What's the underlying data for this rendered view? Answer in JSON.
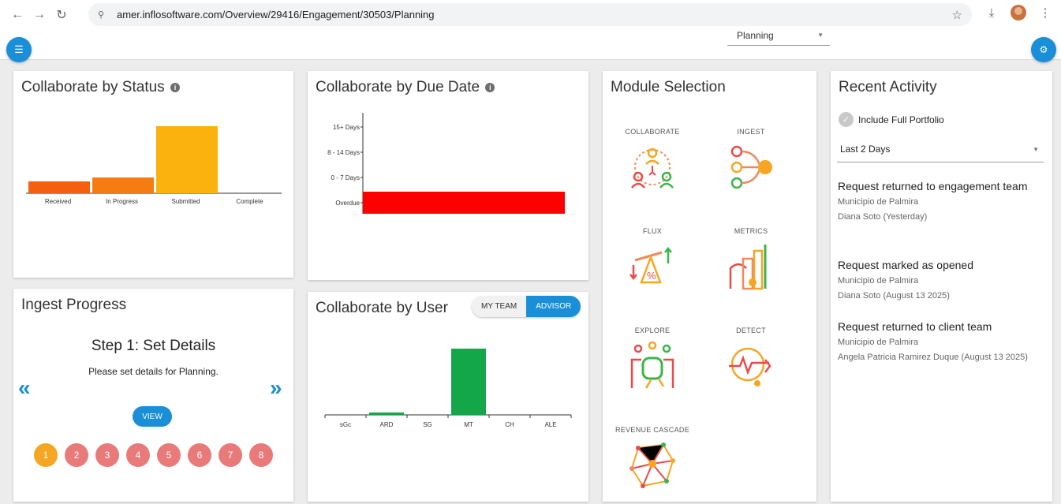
{
  "browser": {
    "url": "amer.inflosoftware.com/Overview/29416/Engagement/30503/Planning",
    "back_icon": "arrow-left-icon",
    "forward_icon": "arrow-right-icon",
    "reload_icon": "reload-icon"
  },
  "header": {
    "phase_select": "Planning"
  },
  "collaborate_status": {
    "title": "Collaborate by Status",
    "chart_data": {
      "type": "bar",
      "categories": [
        "Received",
        "In Progress",
        "Submitted",
        "Complete"
      ],
      "values": [
        6,
        8,
        34,
        0
      ],
      "colors": [
        "#f4600f",
        "#f57c13",
        "#fbb20f",
        "#cccccc"
      ],
      "ylim": [
        0,
        40
      ]
    }
  },
  "collaborate_due": {
    "title": "Collaborate by Due Date",
    "chart_data": {
      "type": "bar",
      "orientation": "horizontal",
      "categories": [
        "15+ Days",
        "8 - 14 Days",
        "0 - 7 Days",
        "Overdue"
      ],
      "values": [
        0,
        0,
        0,
        100
      ],
      "colors": [
        "#ff0000"
      ],
      "xlim": [
        0,
        100
      ]
    }
  },
  "collaborate_user": {
    "title": "Collaborate by User",
    "toggle": {
      "left": "MY TEAM",
      "right": "ADVISOR",
      "selected": "ADVISOR"
    },
    "chart_data": {
      "type": "bar",
      "categories": [
        "sGc",
        "ARD",
        "SG",
        "MT",
        "CH",
        "ALE"
      ],
      "values": [
        0,
        1,
        0,
        28,
        0,
        0
      ],
      "colors": [
        "#13a74a"
      ],
      "ylim": [
        0,
        30
      ]
    }
  },
  "ingest": {
    "title": "Ingest Progress",
    "step_title": "Step 1: Set Details",
    "step_desc": "Please set details for Planning.",
    "view_label": "VIEW",
    "prev_icon": "chevron-double-left-icon",
    "next_icon": "chevron-double-right-icon",
    "steps": [
      "1",
      "2",
      "3",
      "4",
      "5",
      "6",
      "7",
      "8"
    ],
    "active_step": "1"
  },
  "modules": {
    "title": "Module Selection",
    "items": [
      {
        "label": "COLLABORATE",
        "icon": "collaborate-icon"
      },
      {
        "label": "INGEST",
        "icon": "ingest-icon"
      },
      {
        "label": "FLUX",
        "icon": "flux-icon"
      },
      {
        "label": "METRICS",
        "icon": "metrics-icon"
      },
      {
        "label": "EXPLORE",
        "icon": "explore-icon"
      },
      {
        "label": "DETECT",
        "icon": "detect-icon"
      },
      {
        "label": "REVENUE CASCADE",
        "icon": "revenue-cascade-icon"
      }
    ]
  },
  "activity": {
    "title": "Recent Activity",
    "portfolio_label": "Include Full Portfolio",
    "days_select": "Last 2 Days",
    "items": [
      {
        "title": "Request returned to engagement team",
        "entity": "Municipio de Palmira",
        "who": "Diana Soto (Yesterday)"
      },
      {
        "title": "Request marked as opened",
        "entity": "Municipio de Palmira",
        "who": "Diana Soto (August 13 2025)"
      },
      {
        "title": "Request returned to client team",
        "entity": "Municipio de Palmira",
        "who": "Angela Patricia Ramirez Duque (August 13 2025)"
      }
    ]
  }
}
